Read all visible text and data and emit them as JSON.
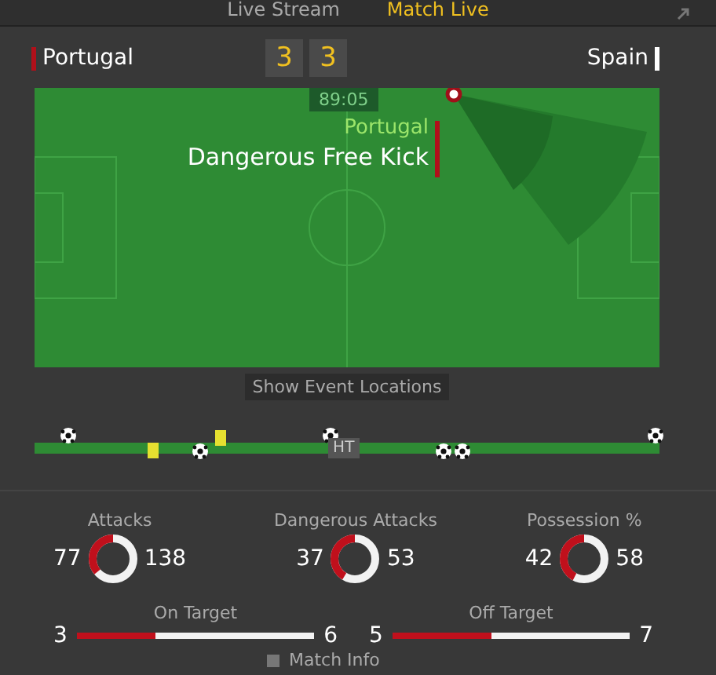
{
  "tabs": [
    {
      "label": "Live Stream",
      "selected": false
    },
    {
      "label": "Match Live",
      "selected": true
    }
  ],
  "score": {
    "home": {
      "name": "Portugal",
      "goals": "3"
    },
    "away": {
      "name": "Spain",
      "goals": "3"
    }
  },
  "pitch": {
    "clock": "89:05",
    "event_team": "Portugal",
    "event": "Dangerous Free Kick"
  },
  "show_locations_button": "Show Event Locations",
  "timeline": {
    "half_label": "HT",
    "events": [
      {
        "kind": "goal_above"
      },
      {
        "kind": "card_below"
      },
      {
        "kind": "goal_below"
      },
      {
        "kind": "card_above"
      },
      {
        "kind": "goal_above"
      },
      {
        "kind": "goal_below"
      },
      {
        "kind": "goal_below"
      },
      {
        "kind": "goal_above"
      }
    ]
  },
  "rings": [
    {
      "label": "Attacks",
      "home": "77",
      "away": "138"
    },
    {
      "label": "Dangerous Attacks",
      "home": "37",
      "away": "53"
    },
    {
      "label": "Possession %",
      "home": "42",
      "away": "58"
    }
  ],
  "bars": [
    {
      "label": "On Target",
      "home": "3",
      "away": "6",
      "level": 0.33
    },
    {
      "label": "Off Target",
      "home": "5",
      "away": "7",
      "level": 0.42
    }
  ],
  "footer": "Match Info"
}
